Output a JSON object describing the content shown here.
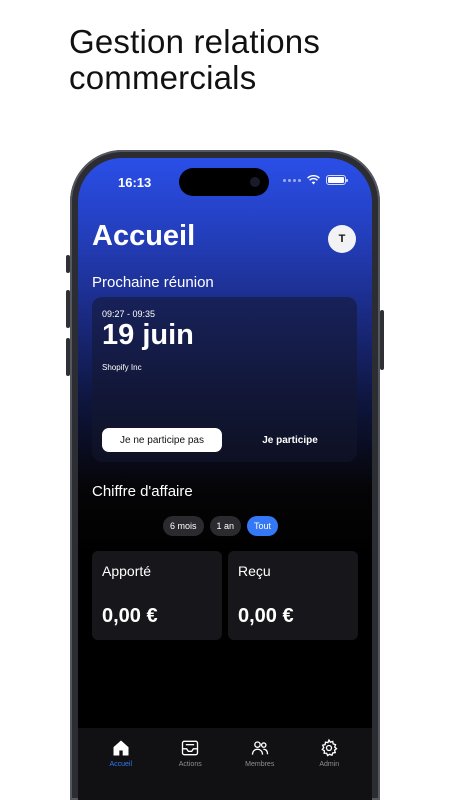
{
  "headline": {
    "line1": "Gestion relations",
    "line2": "commercials"
  },
  "status_bar": {
    "time": "16:13"
  },
  "header": {
    "title": "Accueil",
    "avatar_initial": "T"
  },
  "next_meeting": {
    "section_label": "Prochaine réunion",
    "time_range": "09:27 - 09:35",
    "date": "19 juin",
    "company": "Shopify Inc",
    "decline_label": "Je ne participe pas",
    "accept_label": "Je participe"
  },
  "revenue": {
    "section_label": "Chiffre d'affaire",
    "filters": [
      {
        "label": "6 mois",
        "active": false
      },
      {
        "label": "1 an",
        "active": false
      },
      {
        "label": "Tout",
        "active": true
      }
    ],
    "cards": [
      {
        "label": "Apporté",
        "value": "0,00 €"
      },
      {
        "label": "Reçu",
        "value": "0,00 €"
      }
    ]
  },
  "tabbar": {
    "items": [
      {
        "label": "Accueil",
        "icon": "home-icon",
        "active": true
      },
      {
        "label": "Actions",
        "icon": "inbox-icon",
        "active": false
      },
      {
        "label": "Membres",
        "icon": "users-icon",
        "active": false
      },
      {
        "label": "Admin",
        "icon": "gear-icon",
        "active": false
      }
    ]
  },
  "colors": {
    "accent": "#3478f6",
    "gradient_top": "#2a4ee8",
    "background": "#000000"
  }
}
